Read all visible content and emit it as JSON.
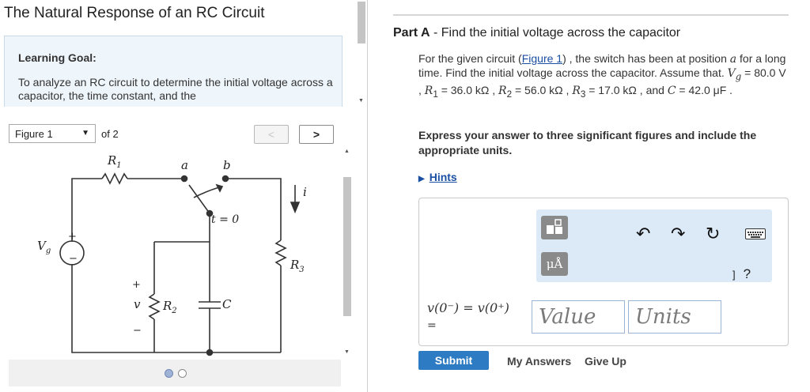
{
  "page": {
    "title": "The Natural Response of an RC Circuit"
  },
  "goal": {
    "title": "Learning Goal:",
    "text": "To analyze an RC circuit to determine the initial voltage across a capacitor, the time constant, and the"
  },
  "figure": {
    "selected": "Figure 1",
    "of": "of 2",
    "prev": "<",
    "next": ">",
    "labels": {
      "R1": "R",
      "R1_sub": "1",
      "a": "a",
      "b": "b",
      "t0": "t = 0",
      "i": "i",
      "Vg": "V",
      "Vg_sub": "g",
      "R3": "R",
      "R3_sub": "3",
      "v": "v",
      "R2": "R",
      "R2_sub": "2",
      "C": "C",
      "plus1": "+",
      "minus1": "−",
      "plus2": "+",
      "minus2": "−"
    }
  },
  "part": {
    "label": "Part A",
    "title": " - Find the initial voltage across the capacitor"
  },
  "problem": {
    "p1": "For the given circuit (",
    "fig_link": "Figure 1",
    "p2": ") , the switch has been at position ",
    "pos": "a",
    "p3": " for a long time. Find the initial voltage across the capacitor. Assume that. ",
    "vg": "V",
    "vg_sub": "g",
    "vg_val": " = 80.0 V , ",
    "r1": "R",
    "r1_sub": "1",
    "r1_val": " = 36.0 kΩ , ",
    "r2": "R",
    "r2_sub": "2",
    "r2_val": " = 56.0 kΩ , ",
    "r3": "R",
    "r3_sub": "3",
    "r3_val": " = 17.0 kΩ , and ",
    "c": "C",
    "c_val": " = 42.0 μF ."
  },
  "instruction": "Express your answer to three significant figures and include the appropriate units.",
  "hints": {
    "label": "Hints"
  },
  "toolbar": {
    "template_icon": "template-icon",
    "mu_label": "μÅ",
    "undo": "↶",
    "redo": "↷",
    "reset": "↻",
    "keyboard_icon": "keyboard-icon",
    "bracket": "]",
    "help": "?"
  },
  "answer": {
    "equation_top": "v(0⁻) = v(0⁺)",
    "equation_eq": "=",
    "value_placeholder": "Value",
    "units_placeholder": "Units"
  },
  "actions": {
    "submit": "Submit",
    "my_answers": "My Answers",
    "give_up": "Give Up"
  },
  "colors": {
    "accent": "#2d7bc2",
    "link": "#1a4fa3",
    "toolbar_bg": "#dce9f7",
    "goal_bg": "#eef5fb"
  }
}
